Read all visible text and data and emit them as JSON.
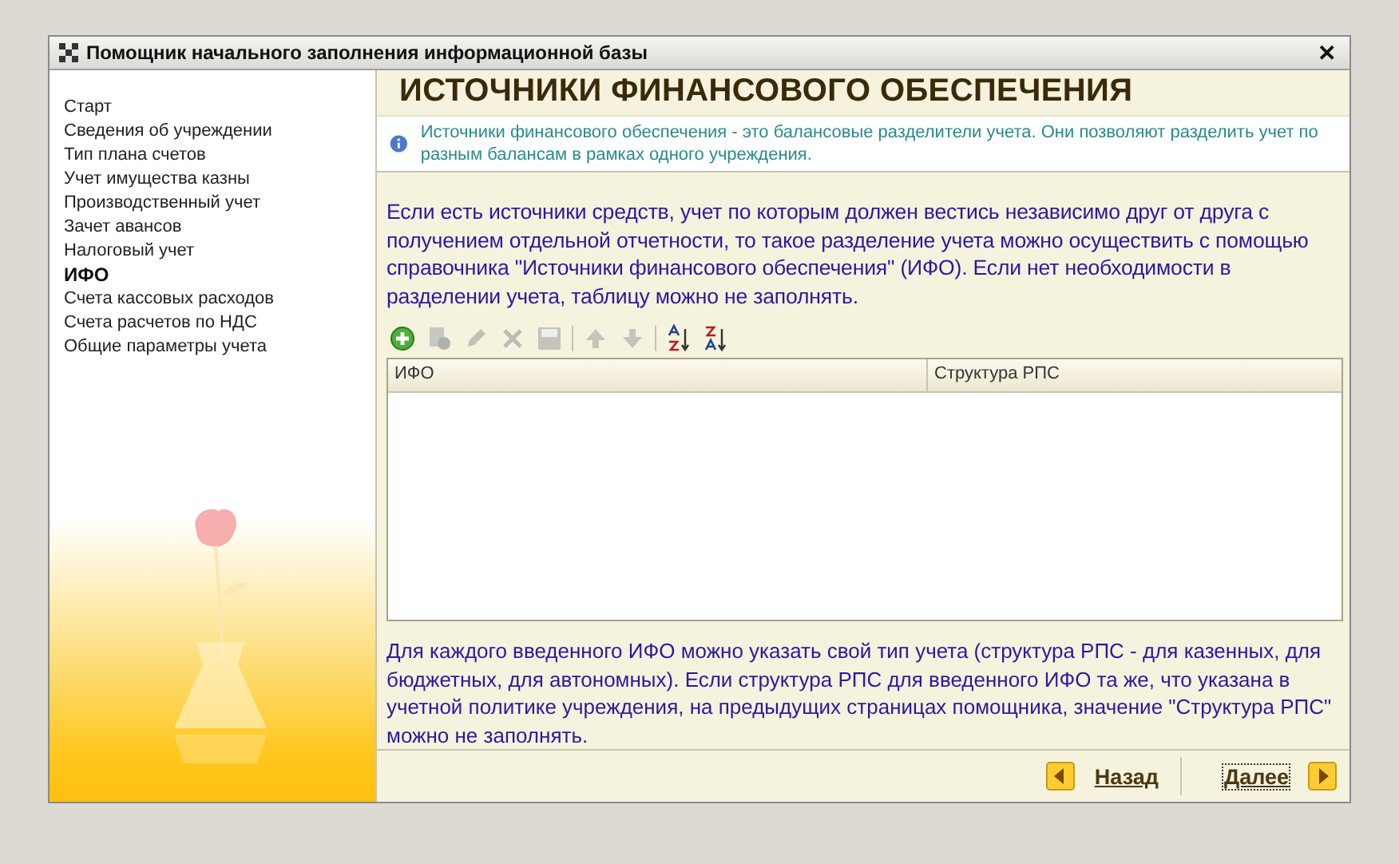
{
  "window": {
    "title": "Помощник начального заполнения информационной базы",
    "close": "✕"
  },
  "sidebar": {
    "items": [
      {
        "label": "Старт",
        "selected": false
      },
      {
        "label": "Сведения об учреждении",
        "selected": false
      },
      {
        "label": "Тип плана счетов",
        "selected": false
      },
      {
        "label": "Учет имущества казны",
        "selected": false
      },
      {
        "label": "Производственный учет",
        "selected": false
      },
      {
        "label": "Зачет авансов",
        "selected": false
      },
      {
        "label": "Налоговый учет",
        "selected": false
      },
      {
        "label": "ИФО",
        "selected": true
      },
      {
        "label": "Счета кассовых расходов",
        "selected": false
      },
      {
        "label": "Счета расчетов по НДС",
        "selected": false
      },
      {
        "label": "Общие параметры учета",
        "selected": false
      }
    ]
  },
  "page": {
    "title": "ИСТОЧНИКИ ФИНАНСОВОГО ОБЕСПЕЧЕНИЯ",
    "info": "Источники финансового обеспечения - это балансовые разделители учета. Они позволяют разделить учет по разным балансам в рамках одного учреждения.",
    "intro": "Если есть источники средств, учет по которым должен вестись независимо друг от друга с получением отдельной отчетности, то такое разделение учета можно осуществить с помощью справочника \"Источники финансового обеспечения\" (ИФО). Если нет необходимости в разделении учета, таблицу можно не заполнять.",
    "toolbar": [
      {
        "kind": "add",
        "disabled": false
      },
      {
        "kind": "copy",
        "disabled": true
      },
      {
        "kind": "edit",
        "disabled": true
      },
      {
        "kind": "delete",
        "disabled": true
      },
      {
        "kind": "save",
        "disabled": true
      },
      {
        "kind": "up",
        "disabled": true
      },
      {
        "kind": "down",
        "disabled": true
      },
      {
        "kind": "sort-asc",
        "disabled": false
      },
      {
        "kind": "sort-desc",
        "disabled": false
      }
    ],
    "table": {
      "columns": [
        "ИФО",
        "Структура РПС"
      ]
    },
    "note": "Для каждого введенного ИФО можно указать свой тип учета (структура РПС - для казенных, для бюджетных, для автономных). Если структура РПС для введенного ИФО та же, что указана в учетной политике учреждения, на предыдущих страницах помощника, значение \"Структура РПС\" можно не заполнять."
  },
  "footer": {
    "buttons": [
      {
        "kind": "back",
        "label": "Назад"
      },
      {
        "kind": "next",
        "label": "Далее"
      }
    ]
  }
}
